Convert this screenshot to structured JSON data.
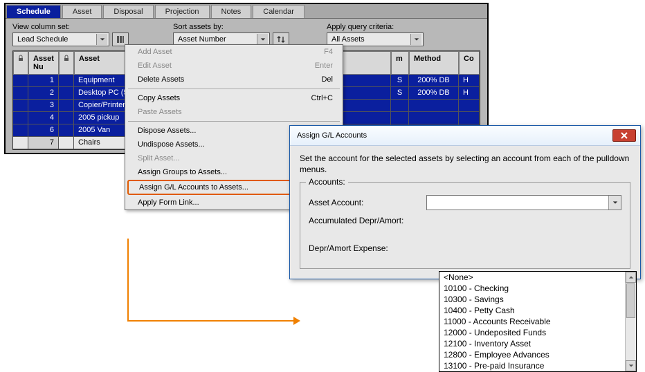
{
  "tabs": [
    "Schedule",
    "Asset",
    "Disposal",
    "Projection",
    "Notes",
    "Calendar"
  ],
  "active_tab": 0,
  "controls": {
    "view_label": "View column set:",
    "view_value": "Lead Schedule",
    "sort_label": "Sort assets by:",
    "sort_value": "Asset  Number",
    "query_label": "Apply query criteria:",
    "query_value": "All Assets"
  },
  "table": {
    "headers": {
      "num": "Asset Nu",
      "name": "Asset",
      "m": "m",
      "method": "Method",
      "co": "Co"
    },
    "rows": [
      {
        "n": "1",
        "name": "Equipment",
        "s": "S",
        "method": "200% DB",
        "h": "H",
        "sel": true
      },
      {
        "n": "2",
        "name": "Desktop PC (5)",
        "s": "S",
        "method": "200% DB",
        "h": "H",
        "sel": true
      },
      {
        "n": "3",
        "name": "Copier/Printer",
        "sel": true
      },
      {
        "n": "4",
        "name": "2005 pickup",
        "sel": true
      },
      {
        "n": "6",
        "name": "2005 Van",
        "sel": true
      },
      {
        "n": "7",
        "name": "Chairs",
        "sel": false
      }
    ]
  },
  "context_menu": [
    {
      "label": "Add Asset",
      "shortcut": "F4",
      "disabled": true
    },
    {
      "label": "Edit Asset",
      "shortcut": "Enter",
      "disabled": true
    },
    {
      "label": "Delete Assets",
      "shortcut": "Del"
    },
    {
      "sep": true
    },
    {
      "label": "Copy Assets",
      "shortcut": "Ctrl+C"
    },
    {
      "label": "Paste Assets",
      "disabled": true
    },
    {
      "sep": true
    },
    {
      "label": "Dispose Assets..."
    },
    {
      "label": "Undispose Assets..."
    },
    {
      "label": "Split Asset...",
      "disabled": true
    },
    {
      "label": "Assign Groups to Assets..."
    },
    {
      "label": "Assign G/L Accounts to Assets...",
      "highlight": true
    },
    {
      "label": "Apply Form Link..."
    }
  ],
  "dialog": {
    "title": "Assign G/L Accounts",
    "text": "Set the account for the selected assets by selecting an account from each of the pulldown menus.",
    "group_label": "Accounts:",
    "fields": [
      {
        "label": "Asset Account:"
      },
      {
        "label": "Accumulated Depr/Amort:"
      },
      {
        "label": "Depr/Amort Expense:"
      }
    ],
    "dropdown_items": [
      "<None>",
      "10100 - Checking",
      "10300 - Savings",
      "10400 - Petty Cash",
      "11000 - Accounts Receivable",
      "12000 - Undeposited Funds",
      "12100 - Inventory Asset",
      "12800 - Employee Advances",
      "13100 - Pre-paid Insurance"
    ]
  }
}
